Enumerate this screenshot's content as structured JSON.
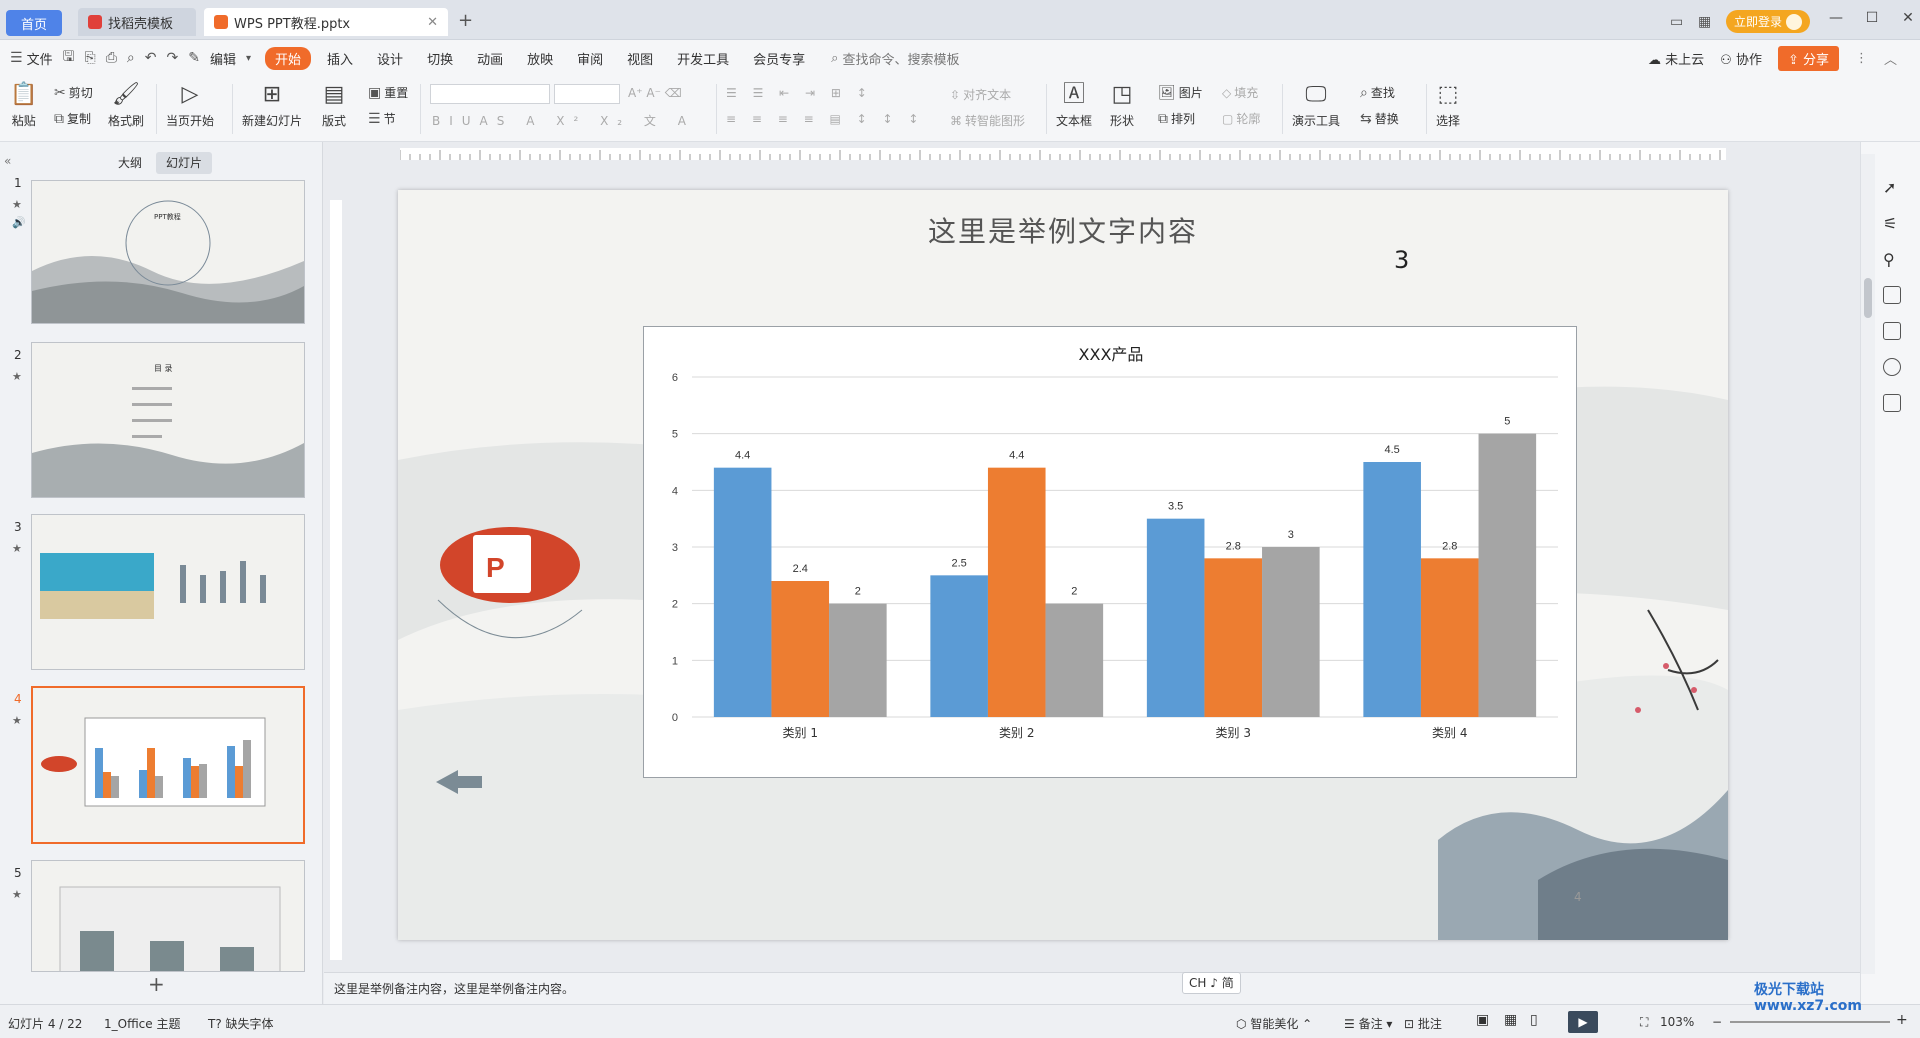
{
  "titlebar": {
    "tabs": [
      "首页",
      "找稻壳模板",
      "WPS PPT教程.pptx"
    ],
    "login": "立即登录"
  },
  "menubar": {
    "file": "文件",
    "edit": "编辑",
    "items": [
      "开始",
      "插入",
      "设计",
      "切换",
      "动画",
      "放映",
      "审阅",
      "视图",
      "开发工具",
      "会员专享"
    ],
    "active": "开始",
    "search": "查找命令、搜索模板",
    "cloud": "未上云",
    "collab": "协作",
    "share": "分享"
  },
  "ribbon": {
    "paste": "粘贴",
    "cut": "剪切",
    "copy": "复制",
    "format_painter": "格式刷",
    "from_current": "当页开始",
    "new_slide": "新建幻灯片",
    "layout": "版式",
    "section": "节",
    "reset": "重置",
    "align_text": "对齐文本",
    "smart_art": "转智能图形",
    "textbox": "文本框",
    "shape": "形状",
    "picture": "图片",
    "fill": "填充",
    "arrange": "排列",
    "outline": "轮廓",
    "present_tools": "演示工具",
    "find": "查找",
    "replace": "替换",
    "select": "选择"
  },
  "left_panel": {
    "tab_outline": "大纲",
    "tab_slides": "幻灯片",
    "slide_numbers": [
      "1",
      "2",
      "3",
      "4",
      "5"
    ],
    "add": "+"
  },
  "slide": {
    "title": "这里是举例文字内容",
    "number_label": "3",
    "page_num": "4"
  },
  "chart_data": {
    "type": "bar",
    "title": "XXX产品",
    "categories": [
      "类别 1",
      "类别 2",
      "类别 3",
      "类别 4"
    ],
    "series": [
      {
        "values": [
          4.4,
          2.5,
          3.5,
          4.5
        ],
        "color": "#5b9bd5"
      },
      {
        "values": [
          2.4,
          4.4,
          2.8,
          2.8
        ],
        "color": "#ed7d31"
      },
      {
        "values": [
          2,
          2,
          3,
          5
        ],
        "color": "#a5a5a5"
      }
    ],
    "ylim": [
      0,
      6
    ],
    "yticks": [
      "0",
      "1",
      "2",
      "3",
      "4",
      "5",
      "6"
    ],
    "grid": true
  },
  "notes": "这里是举例备注内容，这里是举例备注内容。",
  "ime": "CH ♪ 简",
  "status": {
    "slide_count": "幻灯片 4 / 22",
    "theme": "1_Office 主题",
    "missing_font": "缺失字体",
    "smart_beautify": "智能美化",
    "notes": "备注",
    "comments": "批注",
    "zoom": "103%"
  },
  "watermark": "极光下载站 www.xz7.com"
}
